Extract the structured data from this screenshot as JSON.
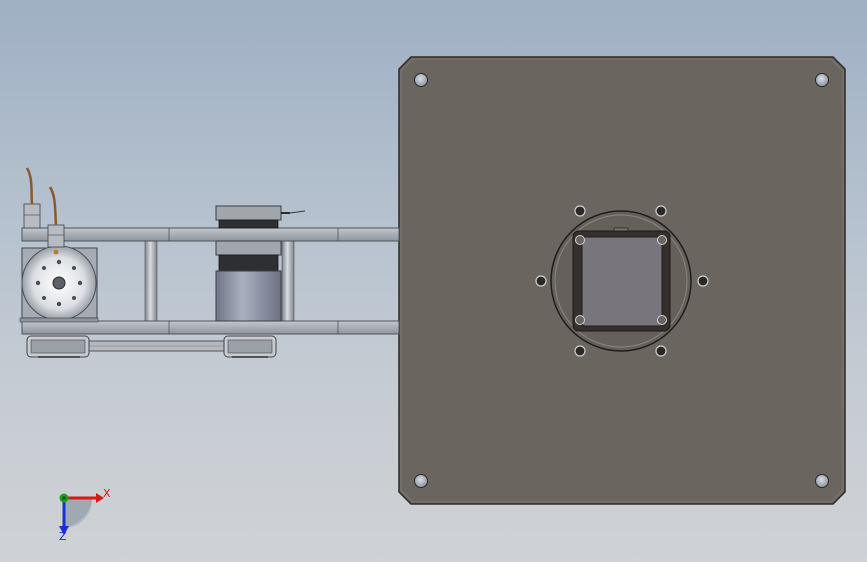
{
  "viewport": {
    "background_top": "#9fb0c4",
    "background_bottom": "#cfd2d6"
  },
  "colors": {
    "plate": "#6b6560",
    "plate_edge": "#2e2b29",
    "arm": "#a7adb4",
    "motor_body": "#8d93a3",
    "cable": "#8a5a2b",
    "axis_x": "#d11a1a",
    "axis_y": "#19a319",
    "axis_z": "#1a2fd1"
  },
  "triad": {
    "x_label": "X",
    "z_label": "Z"
  }
}
